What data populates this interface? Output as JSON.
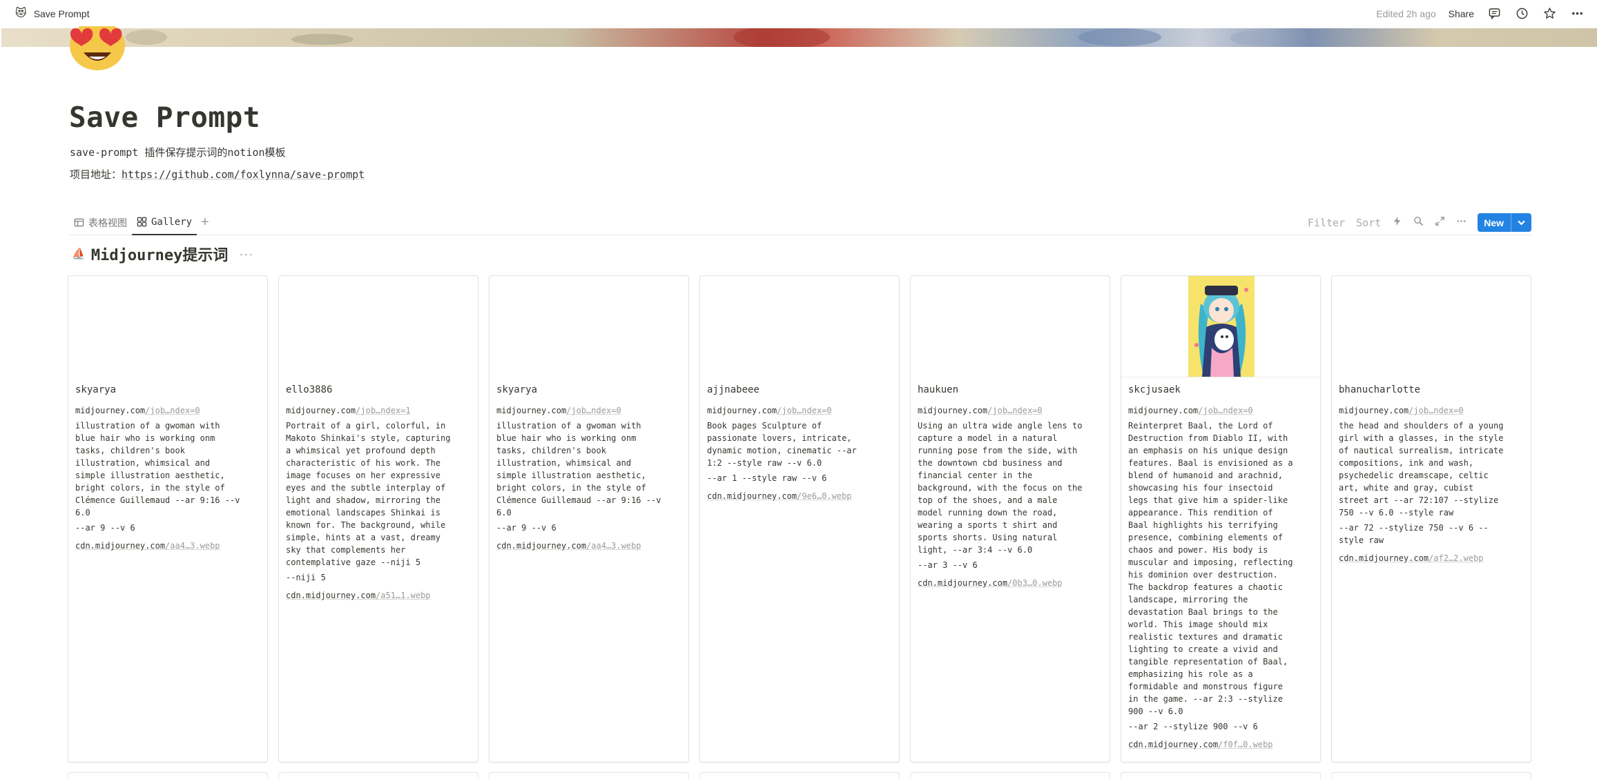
{
  "topbar": {
    "page_emoji": "😻",
    "breadcrumb": "Save Prompt",
    "edited": "Edited 2h ago",
    "share_label": "Share",
    "icons": [
      "comments-icon",
      "history-icon",
      "star-icon",
      "more-icon"
    ]
  },
  "page": {
    "icon_name": "heart-eyes-cat-icon",
    "title": "Save Prompt",
    "description": "save-prompt 插件保存提示词的notion模板",
    "project_label": "项目地址：",
    "project_url": "https://github.com/foxlynna/save-prompt"
  },
  "views": {
    "tabs": [
      {
        "label": "表格视图",
        "icon": "table-icon",
        "active": false
      },
      {
        "label": "Gallery",
        "icon": "gallery-icon",
        "active": true
      }
    ],
    "add_label": "+",
    "filter_label": "Filter",
    "sort_label": "Sort",
    "new_label": "New",
    "tool_icons": [
      "lightning-icon",
      "search-icon",
      "expand-icon",
      "more-icon"
    ]
  },
  "group": {
    "emoji": "⛵",
    "title": "Midjourney提示词",
    "more": "···"
  },
  "cards": [
    {
      "name": "skyarya",
      "link_domain": "midjourney.com",
      "link_path": "/job…ndex=0",
      "prompt": "illustration of a gwoman with\nblue hair who is working onm\ntasks, children's book\nillustration, whimsical and\nsimple illustration aesthetic,\nbright colors, in the style of\nClémence Guillemaud --ar 9:16 --v\n6.0",
      "params": "--ar 9 --v 6",
      "cdn_domain": "cdn.midjourney.com",
      "cdn_path": "/aa4…3.webp",
      "has_image": false
    },
    {
      "name": "ello3886",
      "link_domain": "midjourney.com",
      "link_path": "/job…ndex=1",
      "prompt": "Portrait of a girl, colorful, in\nMakoto Shinkai's style, capturing\na whimsical yet profound depth\ncharacteristic of his work. The\nimage focuses on her expressive\neyes and the subtle interplay of\nlight and shadow, mirroring the\nemotional landscapes Shinkai is\nknown for. The background, while\nsimple, hints at a vast, dreamy\nsky that complements her\ncontemplative gaze --niji 5",
      "params": "--niji 5",
      "cdn_domain": "cdn.midjourney.com",
      "cdn_path": "/a51…1.webp",
      "has_image": false
    },
    {
      "name": "skyarya",
      "link_domain": "midjourney.com",
      "link_path": "/job…ndex=0",
      "prompt": "illustration of a gwoman with\nblue hair who is working onm\ntasks, children's book\nillustration, whimsical and\nsimple illustration aesthetic,\nbright colors, in the style of\nClémence Guillemaud --ar 9:16 --v\n6.0",
      "params": "--ar 9 --v 6",
      "cdn_domain": "cdn.midjourney.com",
      "cdn_path": "/aa4…3.webp",
      "has_image": false
    },
    {
      "name": "ajjnabeee",
      "link_domain": "midjourney.com",
      "link_path": "/job…ndex=0",
      "prompt": "Book pages Sculpture of\npassionate lovers, intricate,\ndynamic motion, cinematic --ar\n1:2 --style raw --v 6.0",
      "params": "--ar 1 --style raw --v 6",
      "cdn_domain": "cdn.midjourney.com",
      "cdn_path": "/9e6…0.webp",
      "has_image": false
    },
    {
      "name": "haukuen",
      "link_domain": "midjourney.com",
      "link_path": "/job…ndex=0",
      "prompt": "Using an ultra wide angle lens to\ncapture a model in a natural\nrunning pose from the side, with\nthe downtown cbd business and\nfinancial center in the\nbackground, with the focus on the\ntop of the shoes, and a male\nmodel running down the road,\nwearing a sports t shirt and\nsports shorts. Using natural\nlight, --ar 3:4 --v 6.0",
      "params": "--ar 3 --v 6",
      "cdn_domain": "cdn.midjourney.com",
      "cdn_path": "/0b3…0.webp",
      "has_image": false
    },
    {
      "name": "skcjusaek",
      "link_domain": "midjourney.com",
      "link_path": "/job…ndex=0",
      "prompt": "Reinterpret Baal, the Lord of\nDestruction from Diablo II, with\nan emphasis on his unique design\nfeatures. Baal is envisioned as a\nblend of humanoid and arachnid,\nshowcasing his four insectoid\nlegs that give him a spider-like\nappearance. This rendition of\nBaal highlights his terrifying\npresence, combining elements of\nchaos and power. His body is\nmuscular and imposing, reflecting\nhis dominion over destruction.\nThe backdrop features a chaotic\nlandscape, mirroring the\ndevastation Baal brings to the\nworld. This image should mix\nrealistic textures and dramatic\nlighting to create a vivid and\ntangible representation of Baal,\nemphasizing his role as a\nformidable and monstrous figure\nin the game. --ar 2:3 --stylize\n900 --v 6.0",
      "params": "--ar 2 --stylize 900 --v 6",
      "cdn_domain": "cdn.midjourney.com",
      "cdn_path": "/f0f…0.webp",
      "has_image": true
    },
    {
      "name": "bhanucharlotte",
      "link_domain": "midjourney.com",
      "link_path": "/job…ndex=0",
      "prompt": "the head and shoulders of a young\ngirl with a glasses, in the style\nof nautical surrealism, intricate\ncompositions, ink and wash,\npsychedelic dreamscape, celtic\nart, white and gray, cubist\nstreet art --ar 72:107 --stylize\n750 --v 6.0 --style raw",
      "params": "--ar 72 --stylize 750 --v 6 --\nstyle raw",
      "cdn_domain": "cdn.midjourney.com",
      "cdn_path": "/af2…2.webp",
      "has_image": false
    }
  ]
}
